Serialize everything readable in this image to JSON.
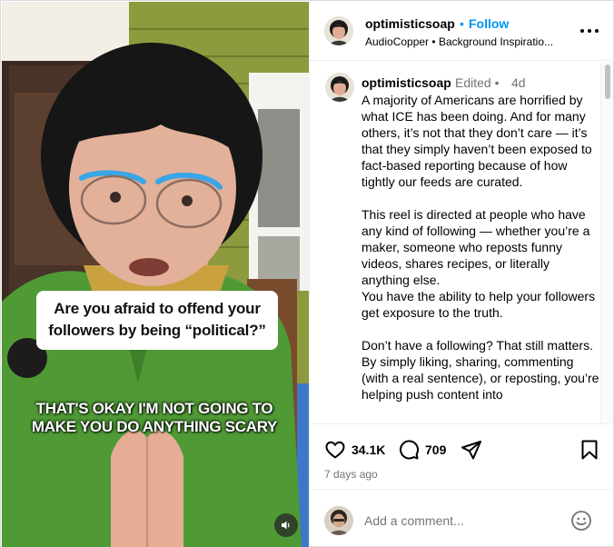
{
  "post": {
    "username": "optimisticsoap",
    "follow_label": "Follow",
    "separator_dot": "•",
    "audio": "AudioCopper",
    "subtitle_separator": "•",
    "subtitle_rest": "Background Inspiratio..."
  },
  "video": {
    "caption_question": "Are you afraid to offend your followers by being “political?”",
    "caption_overlay": "THAT'S OKAY I'M NOT GOING TO MAKE YOU DO ANYTHING SCARY",
    "audio_icon": "speaker-icon"
  },
  "caption": {
    "username": "optimisticsoap",
    "edited": "Edited •",
    "time": "4d",
    "text": "A majority of Americans are horrified by what ICE has been doing. And for many others, it’s not that they don’t care — it’s that they simply haven’t been exposed to fact-based reporting because of how tightly our feeds are curated.\n\nThis reel is directed at people who have any kind of following — whether you’re a maker, someone who reposts funny videos, shares recipes, or literally anything else.\nYou have the ability to help your followers get exposure to the truth.\n\nDon’t have a following? That still matters.\nBy simply liking, sharing, commenting (with a real sentence), or reposting, you’re helping push content into"
  },
  "actions": {
    "likes": "34.1K",
    "comments": "709",
    "date": "7 days ago",
    "icons": [
      "heart-icon",
      "comment-icon",
      "share-icon",
      "save-icon"
    ]
  },
  "comment_box": {
    "placeholder": "Add a comment..."
  },
  "colors": {
    "link_blue": "#0095f6",
    "muted": "#737373",
    "divider": "#efefef",
    "jacket_green": "#4f9a35"
  }
}
